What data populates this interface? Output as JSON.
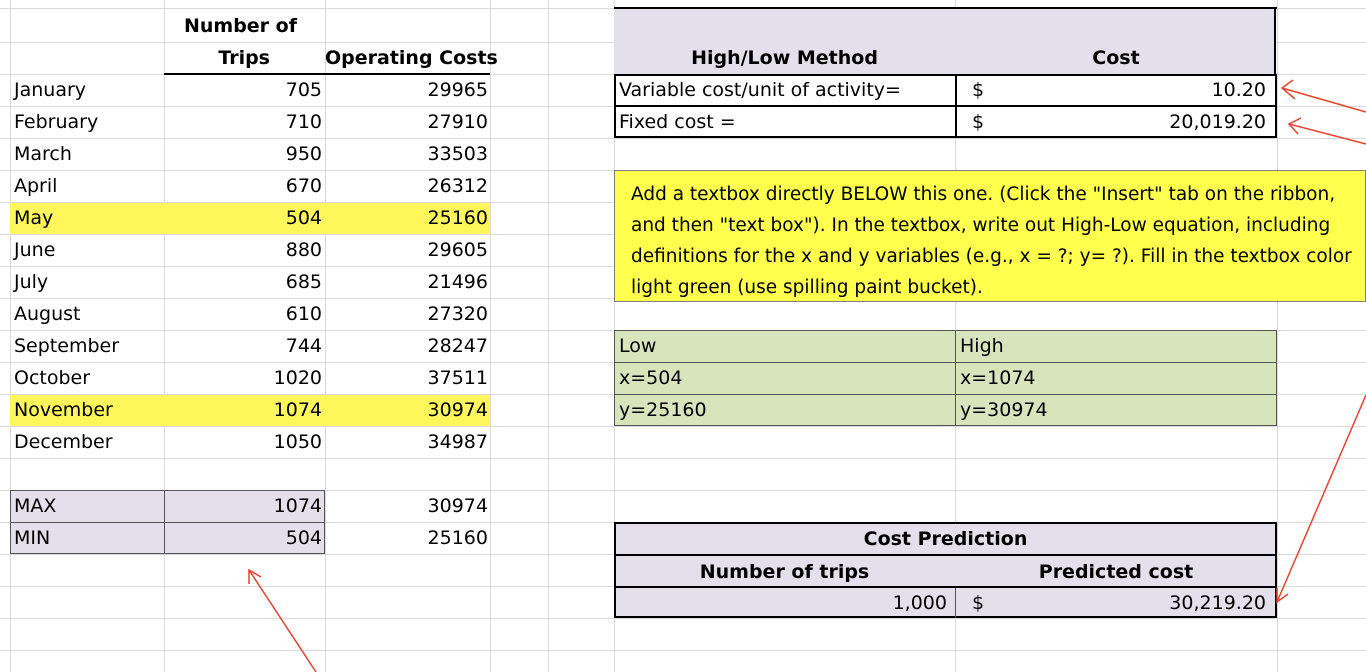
{
  "trips_table": {
    "header_trips_line1": "Number of",
    "header_trips_line2": "Trips",
    "header_costs": "Operating Costs",
    "rows": [
      {
        "month": "January",
        "trips": "705",
        "cost": "29965"
      },
      {
        "month": "February",
        "trips": "710",
        "cost": "27910"
      },
      {
        "month": "March",
        "trips": "950",
        "cost": "33503"
      },
      {
        "month": "April",
        "trips": "670",
        "cost": "26312"
      },
      {
        "month": "May",
        "trips": "504",
        "cost": "25160"
      },
      {
        "month": "June",
        "trips": "880",
        "cost": "29605"
      },
      {
        "month": "July",
        "trips": "685",
        "cost": "21496"
      },
      {
        "month": "August",
        "trips": "610",
        "cost": "27320"
      },
      {
        "month": "September",
        "trips": "744",
        "cost": "28247"
      },
      {
        "month": "October",
        "trips": "1020",
        "cost": "37511"
      },
      {
        "month": "November",
        "trips": "1074",
        "cost": "30974"
      },
      {
        "month": "December",
        "trips": "1050",
        "cost": "34987"
      }
    ],
    "highlighted_rows": [
      "May",
      "November"
    ],
    "max": {
      "label": "MAX",
      "trips": "1074",
      "cost": "30974"
    },
    "min": {
      "label": "MIN",
      "trips": "504",
      "cost": "25160"
    }
  },
  "high_low": {
    "title": "High/Low Method",
    "cost_header": "Cost",
    "variable_label": "Variable cost/unit of activity=",
    "variable_currency": "$",
    "variable_value": "10.20",
    "fixed_label": "Fixed cost =",
    "fixed_currency": "$",
    "fixed_value": "20,019.20"
  },
  "instruction_box": {
    "text": "Add a textbox directly BELOW this one. (Click the \"Insert\" tab on the ribbon,\nand then  \"text box\"). In the textbox, write out  High-Low equation, including\ndefinitions for the x and y variables  (e.g., x = ?; y= ?). Fill in the textbox color\nlight green (use spilling paint bucket)."
  },
  "low_high": {
    "low_header": "Low",
    "high_header": "High",
    "low_x": "x=504",
    "high_x": "x=1074",
    "low_y": "y=25160",
    "high_y": "y=30974"
  },
  "prediction": {
    "title": "Cost Prediction",
    "trips_header": "Number of trips",
    "cost_header": "Predicted cost",
    "trips_value": "1,000",
    "currency": "$",
    "cost_value": "30,219.20"
  },
  "colors": {
    "highlight_yellow": "#fef65b",
    "lavender": "#e3e0ec",
    "light_green": "#d8e4bc",
    "note_yellow": "#ffff4d",
    "arrow_red": "#e8412c"
  }
}
